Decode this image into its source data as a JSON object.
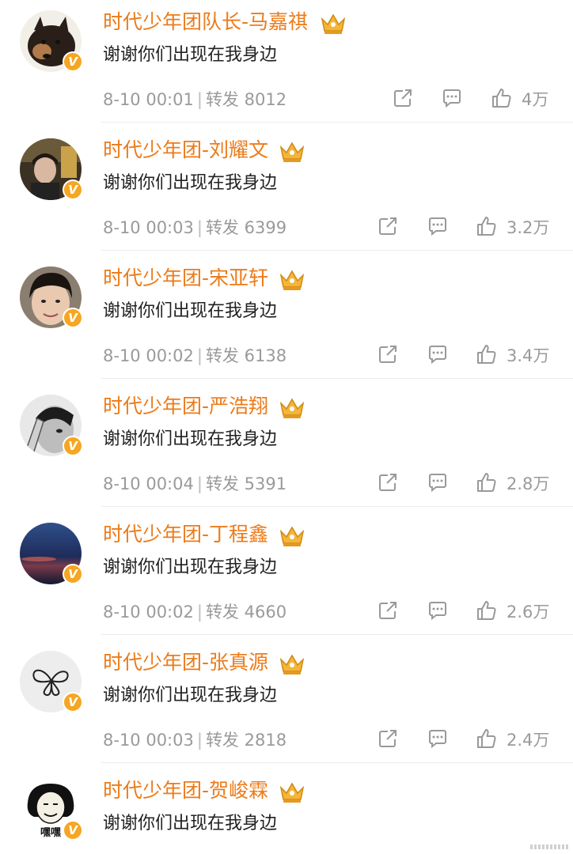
{
  "comments": [
    {
      "name": "时代少年团队长-马嘉祺",
      "text": "谢谢你们出现在我身边",
      "time": "8-10 00:01",
      "repost_label": "转发",
      "reposts": "8012",
      "likes": "4万",
      "avatar": "dog-photo"
    },
    {
      "name": "时代少年团-刘耀文",
      "text": "谢谢你们出现在我身边",
      "time": "8-10 00:03",
      "repost_label": "转发",
      "reposts": "6399",
      "likes": "3.2万",
      "avatar": "person-photo-dark"
    },
    {
      "name": "时代少年团-宋亚轩",
      "text": "谢谢你们出现在我身边",
      "time": "8-10 00:02",
      "repost_label": "转发",
      "reposts": "6138",
      "likes": "3.4万",
      "avatar": "person-photo-face"
    },
    {
      "name": "时代少年团-严浩翔",
      "text": "谢谢你们出现在我身边",
      "time": "8-10 00:04",
      "repost_label": "转发",
      "reposts": "5391",
      "likes": "2.8万",
      "avatar": "person-photo-bw"
    },
    {
      "name": "时代少年团-丁程鑫",
      "text": "谢谢你们出现在我身边",
      "time": "8-10 00:02",
      "repost_label": "转发",
      "reposts": "4660",
      "likes": "2.6万",
      "avatar": "sky-photo"
    },
    {
      "name": "时代少年团-张真源",
      "text": "谢谢你们出现在我身边",
      "time": "8-10 00:03",
      "repost_label": "转发",
      "reposts": "2818",
      "likes": "2.4万",
      "avatar": "butterfly-drawing"
    },
    {
      "name": "时代少年团-贺峻霖",
      "text": "谢谢你们出现在我身边",
      "avatar": "meme-sticker",
      "avatar_caption": "嘿嘿"
    }
  ],
  "colors": {
    "name": "#ec7b1a",
    "badge": "#f5a623",
    "meta": "#9a9a9a"
  },
  "icons": [
    "share-icon",
    "comment-icon",
    "like-icon",
    "verified-badge-icon",
    "crown-icon"
  ]
}
